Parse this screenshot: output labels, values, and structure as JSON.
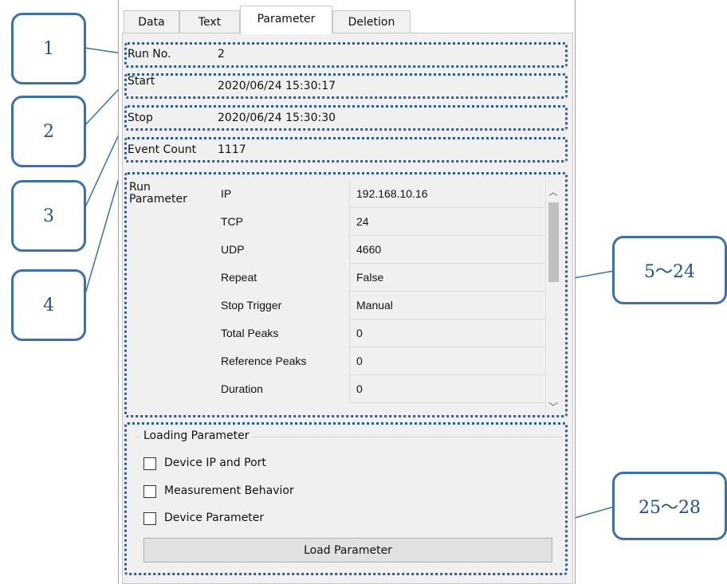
{
  "tabs": [
    "Data",
    "Text",
    "Parameter",
    "Deletion"
  ],
  "active_tab": "Parameter",
  "fields": {
    "run_no": {
      "label": "Run No.",
      "value": "2"
    },
    "start": {
      "label": "Start",
      "value": "2020/06/24  15:30:17"
    },
    "stop": {
      "label": "Stop",
      "value": "2020/06/24  15:30:30"
    },
    "event_count": {
      "label": "Event Count",
      "value": "1117"
    }
  },
  "run_parameter": {
    "label": "Run\nParameter",
    "rows": [
      {
        "key": "IP",
        "value": "192.168.10.16"
      },
      {
        "key": "TCP",
        "value": "24"
      },
      {
        "key": "UDP",
        "value": "4660"
      },
      {
        "key": "Repeat",
        "value": "False"
      },
      {
        "key": "Stop Trigger",
        "value": "Manual"
      },
      {
        "key": "Total Peaks",
        "value": "0"
      },
      {
        "key": "Reference Peaks",
        "value": "0"
      },
      {
        "key": "Duration",
        "value": "0"
      }
    ]
  },
  "loading_parameter": {
    "title": "Loading Parameter",
    "options": [
      {
        "label": "Device IP and Port",
        "checked": false
      },
      {
        "label": "Measurement Behavior",
        "checked": false
      },
      {
        "label": "Device Parameter",
        "checked": false
      }
    ],
    "button_label": "Load Parameter"
  },
  "callouts": [
    "1",
    "2",
    "3",
    "4",
    "5～24",
    "25～28"
  ],
  "colors": {
    "callout_border": "#3a6fb0",
    "callout_text": "#1f4e96",
    "dotted_border": "#2f5c95"
  }
}
